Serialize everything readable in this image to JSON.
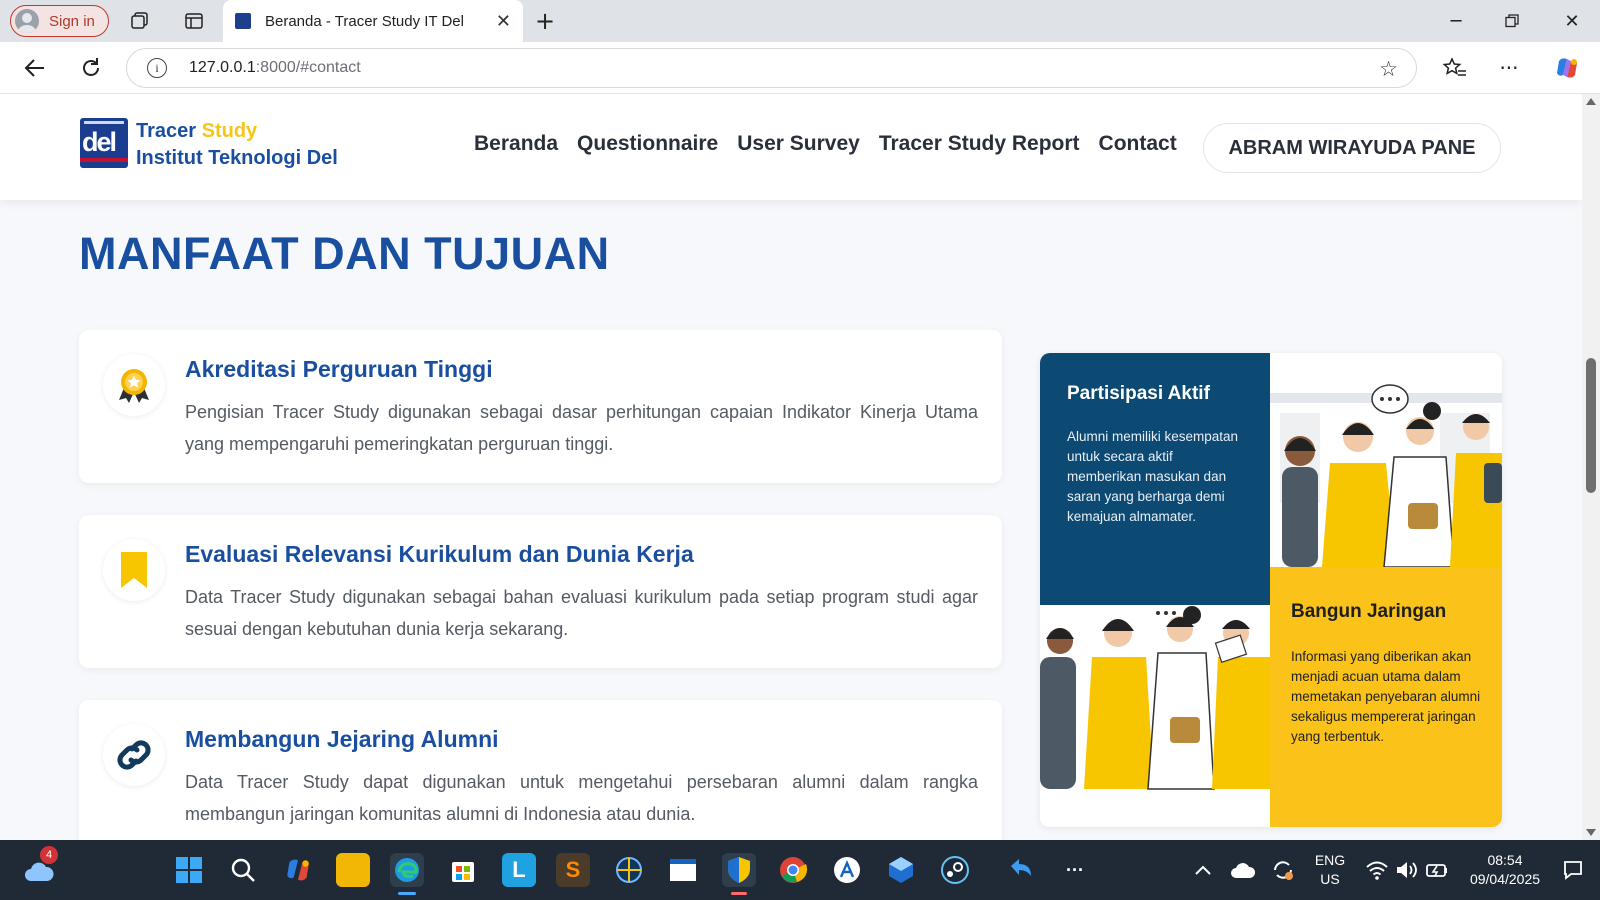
{
  "browser": {
    "signin_label": "Sign in",
    "tab_title": "Beranda - Tracer Study IT Del",
    "url_host": "127.0.0.1",
    "url_rest": ":8000/#contact"
  },
  "site": {
    "logo_text": "del",
    "brand_line1_a": "Tracer",
    "brand_line1_b": "Study",
    "brand_line2": "Institut Teknologi Del",
    "nav": [
      "Beranda",
      "Questionnaire",
      "User Survey",
      "Tracer Study Report",
      "Contact"
    ],
    "user_button": "ABRAM WIRAYUDA PANE"
  },
  "section": {
    "title": "MANFAAT DAN TUJUAN",
    "cards": [
      {
        "icon": "award-icon",
        "title": "Akreditasi Perguruan Tinggi",
        "text": "Pengisian Tracer Study digunakan sebagai dasar perhitungan capaian Indikator Kinerja Utama yang mempengaruhi pemeringkatan perguruan tinggi."
      },
      {
        "icon": "bookmark-icon",
        "title": "Evaluasi Relevansi Kurikulum dan Dunia Kerja",
        "text": "Data Tracer Study digunakan sebagai bahan evaluasi kurikulum pada setiap program studi agar sesuai dengan kebutuhan dunia kerja sekarang."
      },
      {
        "icon": "link-icon",
        "title": "Membangun Jejaring Alumni",
        "text": "Data Tracer Study dapat digunakan untuk mengetahui persebaran alumni dalam rangka membangun jaringan komunitas alumni di Indonesia atau dunia."
      }
    ],
    "panel": {
      "blue_title": "Partisipasi Aktif",
      "blue_text": "Alumni memiliki kesempatan untuk secara aktif memberikan masukan dan saran yang berharga demi kemajuan almamater.",
      "yellow_title": "Bangun Jaringan",
      "yellow_text": "Informasi yang diberikan akan menjadi acuan utama dalam memetakan penyebaran alumni sekaligus mempererat jaringan yang terbentuk."
    }
  },
  "taskbar": {
    "weather_badge": "4",
    "lang_line1": "ENG",
    "lang_line2": "US",
    "time": "08:54",
    "date": "09/04/2025"
  },
  "colors": {
    "brand_blue": "#1a4fa0",
    "accent_yellow": "#f5c518",
    "panel_blue": "#0d4a73",
    "panel_yellow": "#fbc21a"
  }
}
